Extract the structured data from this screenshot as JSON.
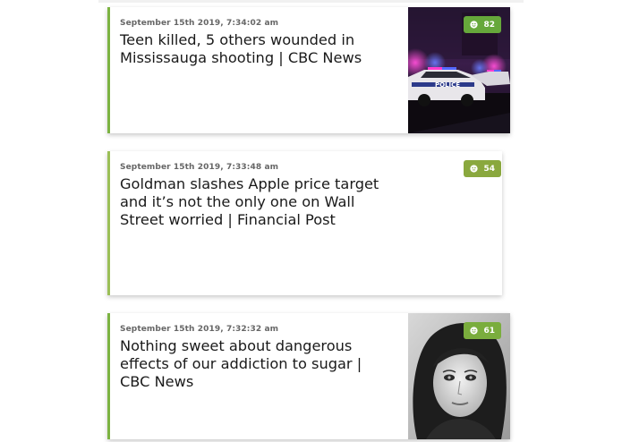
{
  "articles": [
    {
      "timestamp": "September 15th 2019, 7:34:02 am",
      "headline": "Teen killed, 5 others wounded in Mississauga shooting | CBC News",
      "score": "82",
      "sentiment_icon": "smiley-face-icon",
      "badge_color": "#66a83b",
      "has_image": true,
      "image": "police-car-night-photo"
    },
    {
      "timestamp": "September 15th 2019, 7:33:48 am",
      "headline": "Goldman slashes Apple price target and it’s not the only one on Wall Street worried | Financial Post",
      "score": "54",
      "sentiment_icon": "neutral-face-icon",
      "badge_color": "#8aa83e",
      "has_image": false
    },
    {
      "timestamp": "September 15th 2019, 7:32:32 am",
      "headline": "Nothing sweet about dangerous effects of our addiction to sugar | CBC News",
      "score": "61",
      "sentiment_icon": "smiley-face-icon",
      "badge_color": "#7aad3d",
      "has_image": true,
      "image": "woman-portrait-bw-photo"
    }
  ],
  "accent_color": "#7cb342"
}
